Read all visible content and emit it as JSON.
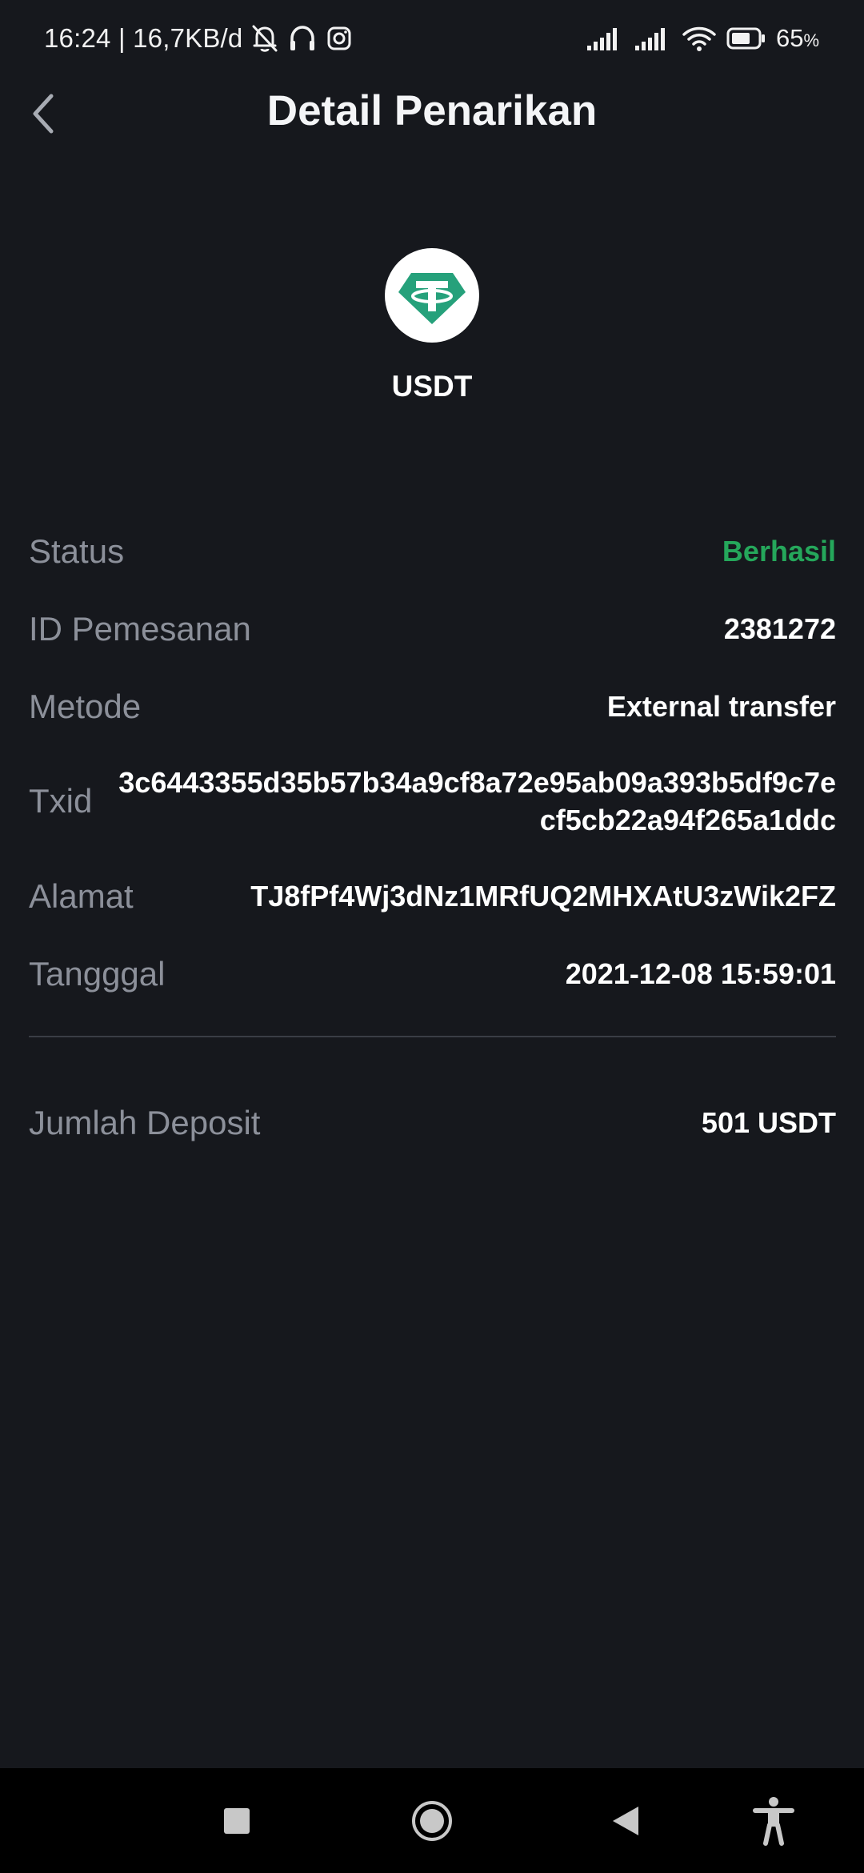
{
  "status_bar": {
    "time_speed": "16:24 | 16,7KB/d",
    "battery_percent": "65",
    "battery_unit": "%"
  },
  "header": {
    "title": "Detail Penarikan"
  },
  "coin": {
    "name": "USDT",
    "logo_icon": "tether-icon",
    "logo_color": "#26a17b"
  },
  "details": {
    "status_label": "Status",
    "status_value": "Berhasil",
    "status_color": "#25a75b",
    "order_id_label": "ID Pemesanan",
    "order_id_value": "2381272",
    "method_label": "Metode",
    "method_value": "External transfer",
    "txid_label": "Txid",
    "txid_value": "3c6443355d35b57b34a9cf8a72e95ab09a393b5df9c7ecf5cb22a94f265a1ddc",
    "address_label": "Alamat",
    "address_value": "TJ8fPf4Wj3dNz1MRfUQ2MHXAtU3zWik2FZ",
    "date_label": "Tangggal",
    "date_value": "2021-12-08 15:59:01"
  },
  "deposit": {
    "label": "Jumlah Deposit",
    "value": "501 USDT"
  },
  "nav_bar": {
    "icons": [
      "recents-icon",
      "home-icon",
      "back-icon",
      "accessibility-icon"
    ]
  }
}
